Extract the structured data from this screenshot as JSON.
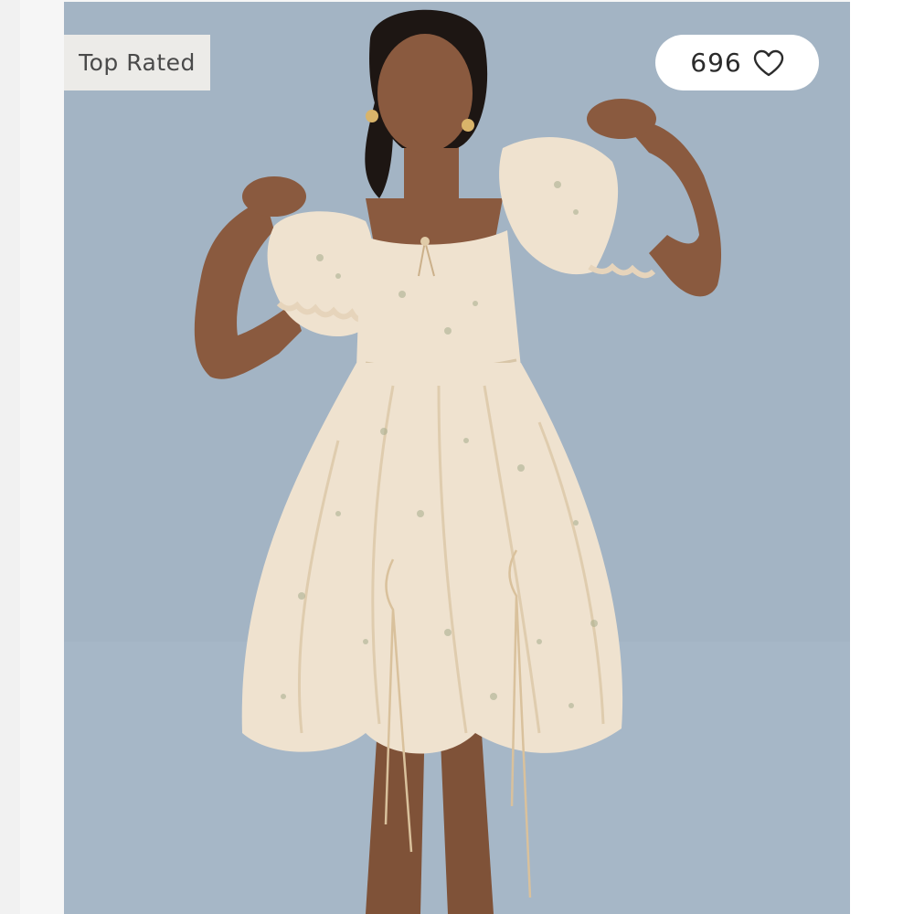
{
  "product_image": {
    "alt": "",
    "background_color": "#a3b4c4",
    "dress_color": "#efe2cf",
    "skin_color": "#8a5a3f",
    "hair_color": "#1d1613"
  },
  "badge": {
    "label": "Top Rated"
  },
  "favorites": {
    "count": "696",
    "icon": "heart-outline-icon"
  }
}
